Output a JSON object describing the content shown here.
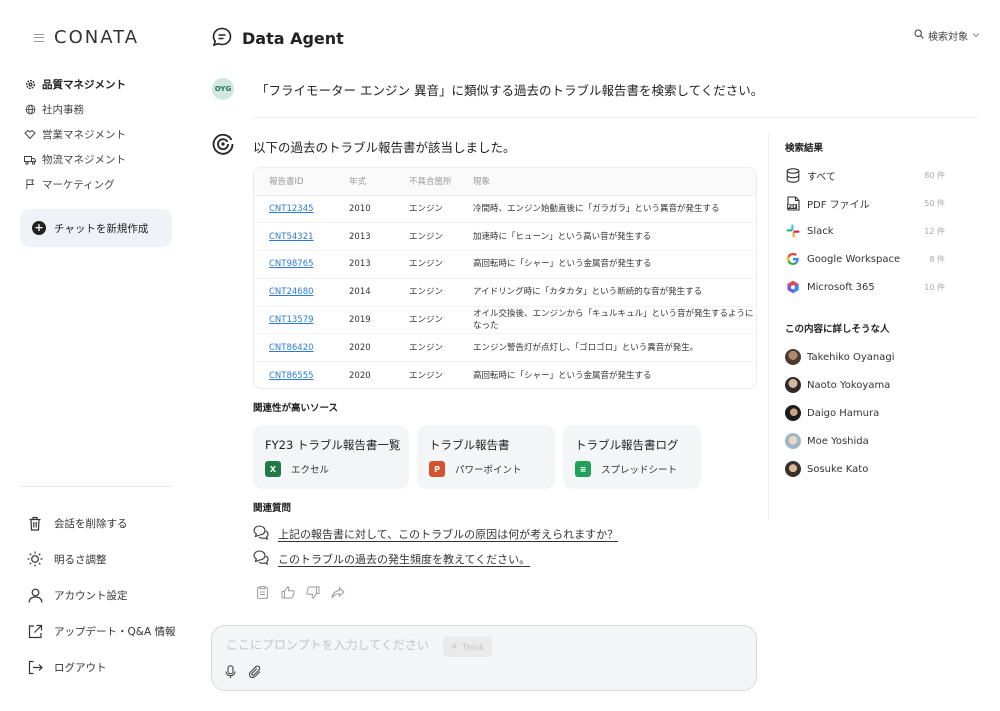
{
  "sidebar": {
    "logo": "CONATA",
    "nav": [
      {
        "label": "品質マネジメント",
        "icon": "gear-icon",
        "active": true
      },
      {
        "label": "社内事務",
        "icon": "globe-icon"
      },
      {
        "label": "営業マネジメント",
        "icon": "handshake-icon"
      },
      {
        "label": "物流マネジメント",
        "icon": "truck-icon"
      },
      {
        "label": "マーケティング",
        "icon": "flag-icon"
      }
    ],
    "new_chat": "チャットを新規作成",
    "bottom": [
      {
        "label": "会話を削除する",
        "icon": "trash-icon"
      },
      {
        "label": "明るさ調整",
        "icon": "sun-icon"
      },
      {
        "label": "アカウント設定",
        "icon": "user-icon"
      },
      {
        "label": "アップデート・Q&A 情報",
        "icon": "external-link-icon"
      },
      {
        "label": "ログアウト",
        "icon": "logout-icon"
      }
    ]
  },
  "header": {
    "title": "Data Agent",
    "search_target": "検索対象"
  },
  "conversation": {
    "user_initials": "OYG",
    "user_message": "「フライモーター エンジン 異音」に類似する過去のトラブル報告書を検索してください。",
    "agent_intro": "以下の過去のトラブル報告書が該当しました。",
    "table": {
      "headers": [
        "報告書ID",
        "年式",
        "不具合箇所",
        "現象"
      ],
      "rows": [
        [
          "CNT12345",
          "2010",
          "エンジン",
          "冷間時、エンジン始動直後に「ガラガラ」という異音が発生する"
        ],
        [
          "CNT54321",
          "2013",
          "エンジン",
          "加速時に「ヒューン」という高い音が発生する"
        ],
        [
          "CNT98765",
          "2013",
          "エンジン",
          "高回転時に「シャー」という金属音が発生する"
        ],
        [
          "CNT24680",
          "2014",
          "エンジン",
          "アイドリング時に「カタカタ」という断続的な音が発生する"
        ],
        [
          "CNT13579",
          "2019",
          "エンジン",
          "オイル交換後、エンジンから「キュルキュル」という音が発生するようになった"
        ],
        [
          "CNT86420",
          "2020",
          "エンジン",
          "エンジン警告灯が点灯し、「ゴロゴロ」という異音が発生。"
        ],
        [
          "CNT86555",
          "2020",
          "エンジン",
          "高回転時に「シャー」という金属音が発生する"
        ]
      ]
    },
    "sources_label": "関連性が高いソース",
    "sources": [
      {
        "title": "FY23 トラブル報告書一覧",
        "type": "エクセル",
        "badge": "X",
        "color": "#1f7a45"
      },
      {
        "title": "トラブル報告書",
        "type": "パワーポイント",
        "badge": "P",
        "color": "#d35230"
      },
      {
        "title": "トラブル報告書ログ",
        "type": "スプレッドシート",
        "badge": "≡",
        "color": "#20a25a"
      }
    ],
    "related_label": "関連質問",
    "related": [
      "上記の報告書に対して、このトラブルの原因は何が考えられますか？",
      "このトラブルの過去の発生頻度を教えてください。"
    ]
  },
  "composer": {
    "placeholder": "ここにプロンプトを入力してください",
    "think_label": "Think"
  },
  "right_panel": {
    "results_title": "検索結果",
    "results": [
      {
        "label": "すべて",
        "count": "80 件",
        "icon": "database-icon"
      },
      {
        "label": "PDF ファイル",
        "count": "50 件",
        "icon": "pdf-icon"
      },
      {
        "label": "Slack",
        "count": "12 件",
        "icon": "slack-icon"
      },
      {
        "label": "Google Workspace",
        "count": "8 件",
        "icon": "google-icon"
      },
      {
        "label": "Microsoft 365",
        "count": "10 件",
        "icon": "microsoft-365-icon"
      }
    ],
    "people_title": "この内容に詳しそうな人",
    "people": [
      {
        "name": "Takehiko Oyanagi"
      },
      {
        "name": "Naoto Yokoyama"
      },
      {
        "name": "Daigo Hamura"
      },
      {
        "name": "Moe Yoshida"
      },
      {
        "name": "Sosuke Kato"
      }
    ]
  }
}
